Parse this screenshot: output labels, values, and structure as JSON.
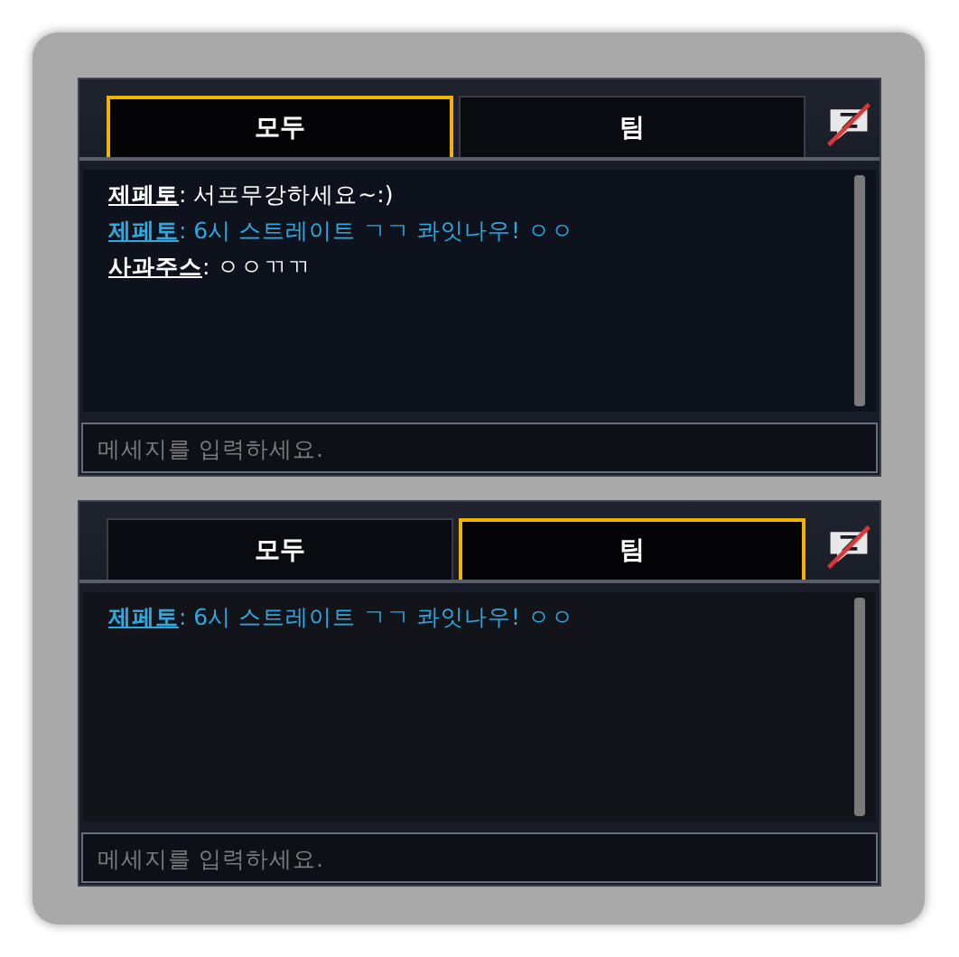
{
  "panels": [
    {
      "tabs": [
        {
          "label": "모두",
          "selected": true
        },
        {
          "label": "팀",
          "selected": false
        }
      ],
      "messages": [
        {
          "sender": "제페토",
          "text": ": 서프무강하세요~:)",
          "color": "#ffffff"
        },
        {
          "sender": "제페토",
          "text": ": 6시 스트레이트 ㄱㄱ 콰잇나우! ㅇㅇ",
          "color": "#2fa8e0"
        },
        {
          "sender": "사과주스",
          "text": ": ㅇㅇㄲㄲ",
          "color": "#ffffff"
        }
      ],
      "input": {
        "placeholder": "메세지를 입력하세요."
      }
    },
    {
      "tabs": [
        {
          "label": "모두",
          "selected": false
        },
        {
          "label": "팀",
          "selected": true
        }
      ],
      "messages": [
        {
          "sender": "제페토",
          "text": ": 6시 스트레이트 ㄱㄱ 콰잇나우! ㅇㅇ",
          "color": "#2fa8e0"
        }
      ],
      "input": {
        "placeholder": "메세지를 입력하세요."
      }
    }
  ]
}
